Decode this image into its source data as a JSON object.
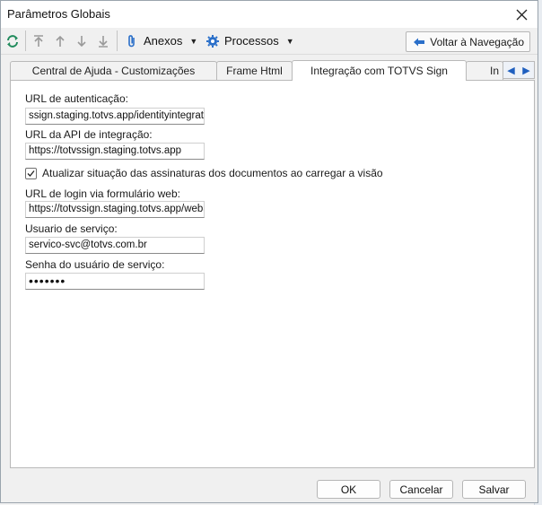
{
  "window": {
    "title": "Parâmetros Globais"
  },
  "toolbar": {
    "anexos_label": "Anexos",
    "processos_label": "Processos",
    "back_label": "Voltar à Navegação"
  },
  "tabs": [
    {
      "label": "Central de Ajuda - Customizações"
    },
    {
      "label": "Frame Html"
    },
    {
      "label": "Integração com TOTVS Sign"
    },
    {
      "label": "In"
    }
  ],
  "form": {
    "auth_url_label": "URL de autenticação:",
    "auth_url_value": "ssign.staging.totvs.app/identityintegration",
    "api_url_label": "URL da API de integração:",
    "api_url_value": "https://totvssign.staging.totvs.app",
    "update_checkbox_label": "Atualizar situação das assinaturas dos documentos ao carregar a visão",
    "login_url_label": "URL de login via formulário web:",
    "login_url_value": "https://totvssign.staging.totvs.app/webap",
    "service_user_label": "Usuario de serviço:",
    "service_user_value": "servico-svc@totvs.com.br",
    "service_password_label": "Senha do usuário de serviço:",
    "service_password_mask": "•••••••"
  },
  "footer": {
    "ok_label": "OK",
    "cancel_label": "Cancelar",
    "save_label": "Salvar"
  },
  "colors": {
    "accent": "#1f5fbf",
    "icon_green": "#1f8a5b",
    "icon_blue": "#2a6fc9"
  }
}
